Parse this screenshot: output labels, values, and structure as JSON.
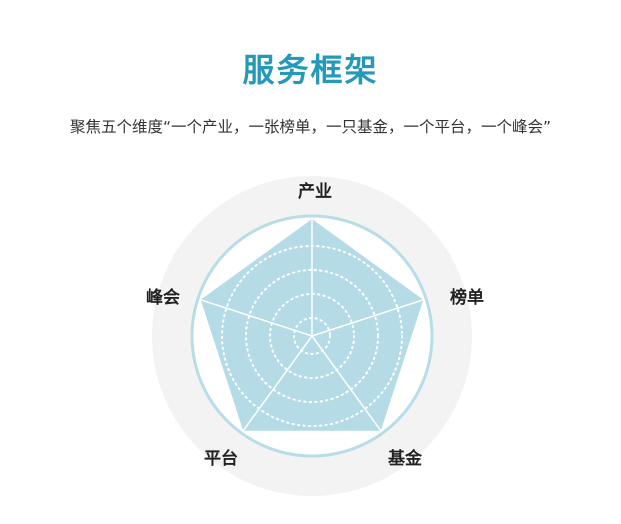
{
  "header": {
    "title": "服务框架",
    "subtitle": "聚焦五个维度“一个产业，一张榜单，一只基金，一个平台，一个峰会”"
  },
  "colors": {
    "title": "#2599b8",
    "fill": "#b4dbe6",
    "ring": "#b8dde8",
    "outer_disc": "#f3f3f3"
  },
  "chart_data": {
    "type": "radar",
    "title": "",
    "axes": [
      "产业",
      "榜单",
      "基金",
      "平台",
      "峰会"
    ],
    "values": [
      1,
      1,
      1,
      1,
      1
    ],
    "range": [
      0,
      1
    ],
    "gridlines": "dotted concentric circles"
  }
}
